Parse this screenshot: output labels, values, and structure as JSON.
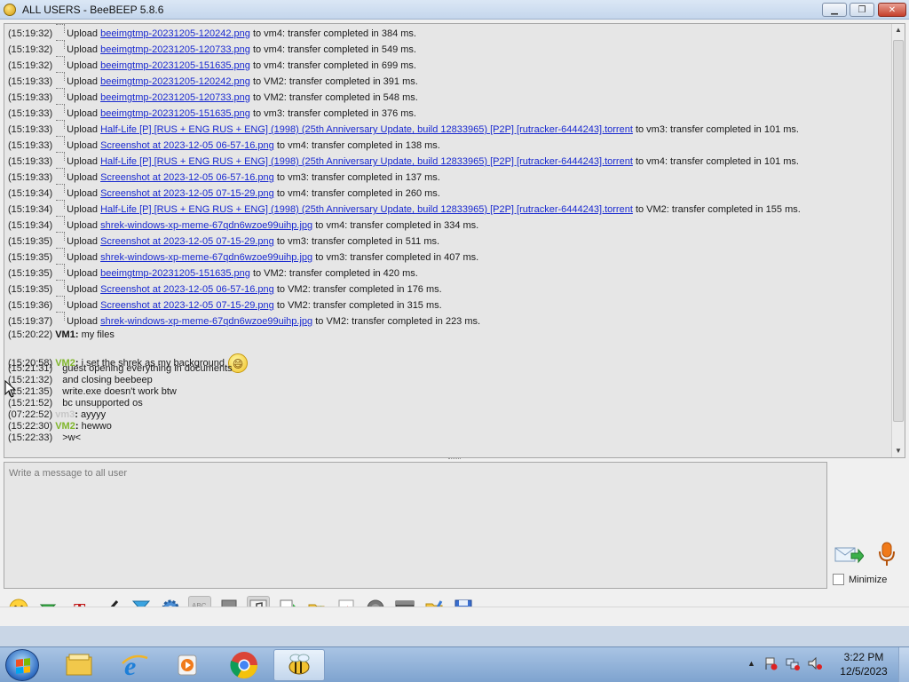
{
  "window": {
    "title": "ALL USERS - BeeBEEP 5.8.6",
    "controls": {
      "minimize": "▁",
      "maximize": "❐",
      "close": "✕"
    }
  },
  "transfers": [
    {
      "time": "(15:19:32)",
      "action": "Upload",
      "file": "beeimgtmp-20231205-120242.png",
      "rest": "to vm4: transfer completed in 384 ms."
    },
    {
      "time": "(15:19:32)",
      "action": "Upload",
      "file": "beeimgtmp-20231205-120733.png",
      "rest": "to vm4: transfer completed in 549 ms."
    },
    {
      "time": "(15:19:32)",
      "action": "Upload",
      "file": "beeimgtmp-20231205-151635.png",
      "rest": "to vm4: transfer completed in 699 ms."
    },
    {
      "time": "(15:19:33)",
      "action": "Upload",
      "file": "beeimgtmp-20231205-120242.png",
      "rest": "to VM2: transfer completed in 391 ms."
    },
    {
      "time": "(15:19:33)",
      "action": "Upload",
      "file": "beeimgtmp-20231205-120733.png",
      "rest": "to VM2: transfer completed in 548 ms."
    },
    {
      "time": "(15:19:33)",
      "action": "Upload",
      "file": "beeimgtmp-20231205-151635.png",
      "rest": "to vm3: transfer completed in 376 ms."
    },
    {
      "time": "(15:19:33)",
      "action": "Upload",
      "file": "Half-Life [P] [RUS + ENG RUS + ENG] (1998) (25th Anniversary Update, build 12833965) [P2P] [rutracker-6444243].torrent",
      "rest": "to vm3: transfer completed in 101 ms."
    },
    {
      "time": "(15:19:33)",
      "action": "Upload",
      "file": "Screenshot at 2023-12-05 06-57-16.png",
      "rest": "to vm4: transfer completed in 138 ms."
    },
    {
      "time": "(15:19:33)",
      "action": "Upload",
      "file": "Half-Life [P] [RUS + ENG RUS + ENG] (1998) (25th Anniversary Update, build 12833965) [P2P] [rutracker-6444243].torrent",
      "rest": "to vm4: transfer completed in 101 ms."
    },
    {
      "time": "(15:19:33)",
      "action": "Upload",
      "file": "Screenshot at 2023-12-05 06-57-16.png",
      "rest": "to vm3: transfer completed in 137 ms."
    },
    {
      "time": "(15:19:34)",
      "action": "Upload",
      "file": "Screenshot at 2023-12-05 07-15-29.png",
      "rest": "to vm4: transfer completed in 260 ms."
    },
    {
      "time": "(15:19:34)",
      "action": "Upload",
      "file": "Half-Life [P] [RUS + ENG RUS + ENG] (1998) (25th Anniversary Update, build 12833965) [P2P] [rutracker-6444243].torrent",
      "rest": "to VM2: transfer completed in 155 ms."
    },
    {
      "time": "(15:19:34)",
      "action": "Upload",
      "file": "shrek-windows-xp-meme-67qdn6wzoe99uihp.jpg",
      "rest": "to vm4: transfer completed in 334 ms."
    },
    {
      "time": "(15:19:35)",
      "action": "Upload",
      "file": "Screenshot at 2023-12-05 07-15-29.png",
      "rest": "to vm3: transfer completed in 511 ms."
    },
    {
      "time": "(15:19:35)",
      "action": "Upload",
      "file": "shrek-windows-xp-meme-67qdn6wzoe99uihp.jpg",
      "rest": "to vm3: transfer completed in 407 ms."
    },
    {
      "time": "(15:19:35)",
      "action": "Upload",
      "file": "beeimgtmp-20231205-151635.png",
      "rest": "to VM2: transfer completed in 420 ms."
    },
    {
      "time": "(15:19:35)",
      "action": "Upload",
      "file": "Screenshot at 2023-12-05 06-57-16.png",
      "rest": "to VM2: transfer completed in 176 ms."
    },
    {
      "time": "(15:19:36)",
      "action": "Upload",
      "file": "Screenshot at 2023-12-05 07-15-29.png",
      "rest": "to VM2: transfer completed in 315 ms."
    },
    {
      "time": "(15:19:37)",
      "action": "Upload",
      "file": "shrek-windows-xp-meme-67qdn6wzoe99uihp.jpg",
      "rest": "to VM2: transfer completed in 223 ms."
    }
  ],
  "messages": [
    {
      "time": "(15:20:22)",
      "nick": "VM1",
      "nick_class": "vm1",
      "text": "my files"
    },
    {
      "time": "(15:20:58)",
      "nick": "VM2",
      "nick_class": "vm2",
      "text": "i set the shrek as my background",
      "emoji": "😄"
    },
    {
      "time": "(15:21:31)",
      "nick": "",
      "nick_class": "",
      "text": "guest opening everything in documents"
    },
    {
      "time": "(15:21:32)",
      "nick": "",
      "nick_class": "",
      "text": "and closing beebeep"
    },
    {
      "time": "(15:21:35)",
      "nick": "",
      "nick_class": "",
      "text": "write.exe doesn't work btw"
    },
    {
      "time": "(15:21:52)",
      "nick": "",
      "nick_class": "",
      "text": "bc unsupported os"
    },
    {
      "time": "(07:22:52)",
      "nick": "vm3",
      "nick_class": "vm3",
      "text": "ayyyy"
    },
    {
      "time": "(15:22:30)",
      "nick": "VM2",
      "nick_class": "vm2",
      "text": "hewwo"
    },
    {
      "time": "(15:22:33)",
      "nick": "",
      "nick_class": "",
      "text": ">w<"
    }
  ],
  "composer": {
    "placeholder": "Write a message to all user",
    "minimize_label": "Minimize",
    "minimize_checked": false
  },
  "toolbar": [
    "emoticons-icon",
    "file-share-icon",
    "font-icon",
    "color-icon",
    "filter-icon",
    "settings-icon",
    "spellcheck-icon",
    "dictionary-icon",
    "sound-icon",
    "export-icon",
    "send-file-icon",
    "html-icon",
    "record-icon",
    "terminal-icon",
    "folder-icon",
    "save-icon"
  ],
  "taskbar": {
    "apps": [
      "explorer",
      "internet-explorer",
      "media-player",
      "chrome",
      "beebeep"
    ],
    "time": "3:22 PM",
    "date": "12/5/2023"
  }
}
